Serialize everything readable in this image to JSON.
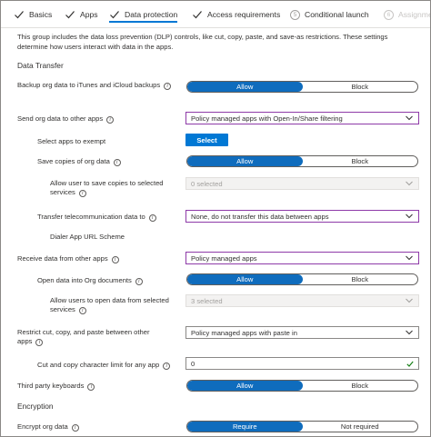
{
  "steps": [
    {
      "label": "Basics",
      "state": "done"
    },
    {
      "label": "Apps",
      "state": "done"
    },
    {
      "label": "Data protection",
      "state": "active"
    },
    {
      "label": "Access requirements",
      "state": "done"
    },
    {
      "num": "5",
      "label": "Conditional launch",
      "state": "todo"
    },
    {
      "num": "6",
      "label": "Assignme",
      "state": "faded"
    }
  ],
  "intro": "This group includes the data loss prevention (DLP) controls, like cut, copy, paste, and save-as restrictions. These settings determine how users interact with data in the apps.",
  "sections": {
    "data_transfer": "Data Transfer",
    "encryption": "Encryption"
  },
  "settings": {
    "backup": {
      "label": "Backup org data to iTunes and iCloud backups",
      "on": "Allow",
      "off": "Block"
    },
    "send": {
      "label": "Send org data to other apps",
      "value": "Policy managed apps with Open-In/Share filtering"
    },
    "select_apps": {
      "label": "Select apps to exempt",
      "button": "Select"
    },
    "save_copies": {
      "label": "Save copies of org data",
      "on": "Allow",
      "off": "Block"
    },
    "allow_save_services": {
      "label": "Allow user to save copies to selected services",
      "value": "0 selected"
    },
    "telecom": {
      "label": "Transfer telecommunication data to",
      "value": "None, do not transfer this data between apps"
    },
    "dialer": {
      "label": "Dialer App URL Scheme"
    },
    "receive": {
      "label": "Receive data from other apps",
      "value": "Policy managed apps"
    },
    "open_into": {
      "label": "Open data into Org documents",
      "on": "Allow",
      "off": "Block"
    },
    "open_services": {
      "label": "Allow users to open data from selected services",
      "value": "3 selected"
    },
    "restrict_cut": {
      "label": "Restrict cut, copy, and paste between other apps",
      "value": "Policy managed apps with paste in"
    },
    "char_limit": {
      "label": "Cut and copy character limit for any app",
      "value": "0"
    },
    "keyboards": {
      "label": "Third party keyboards",
      "on": "Allow",
      "off": "Block"
    },
    "encrypt": {
      "label": "Encrypt org data",
      "on": "Require",
      "off": "Not required"
    }
  },
  "colors": {
    "accent": "#0078d4",
    "focus_border": "#8e3aa8"
  }
}
